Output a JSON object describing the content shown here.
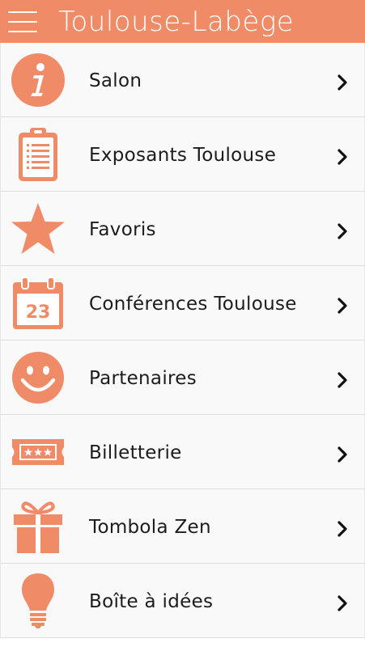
{
  "header": {
    "title": "Toulouse-Labège",
    "menu_icon": "hamburger-menu-icon",
    "background_color": "#f08b68"
  },
  "accent_color": "#f08b68",
  "menu": {
    "items": [
      {
        "label": "Salon",
        "icon": "info-icon"
      },
      {
        "label": "Exposants Toulouse",
        "icon": "clipboard-list-icon"
      },
      {
        "label": "Favoris",
        "icon": "star-icon"
      },
      {
        "label": "Conférences Toulouse",
        "icon": "calendar-icon",
        "icon_text": "23"
      },
      {
        "label": "Partenaires",
        "icon": "smiley-icon"
      },
      {
        "label": "Billetterie",
        "icon": "ticket-icon"
      },
      {
        "label": "Tombola Zen",
        "icon": "gift-icon"
      },
      {
        "label": "Boîte à idées",
        "icon": "lightbulb-icon"
      }
    ]
  }
}
